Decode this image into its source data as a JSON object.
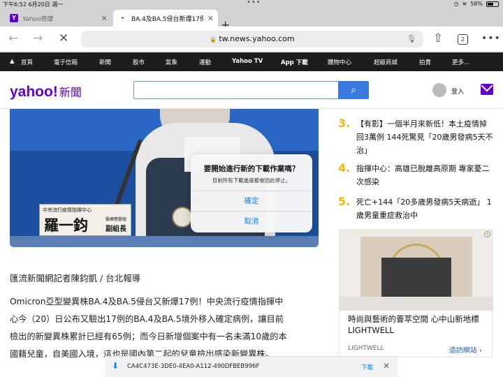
{
  "status": {
    "time": "下午6:52  6月20日 週一",
    "battery": "58%",
    "battery_level": 0.58
  },
  "tabs": [
    {
      "title": "Yahoo奇摩",
      "active": false
    },
    {
      "title": "BA.4及BA.5侵台新爆17例",
      "active": true
    }
  ],
  "address": {
    "url": "tw.news.yahoo.com",
    "tab_count": "2"
  },
  "nav": [
    "首頁",
    "電子信箱",
    "新聞",
    "股市",
    "氣象",
    "運動",
    "Yahoo TV",
    "App 下載",
    "購物中心",
    "超級商城",
    "拍賣",
    "更多..."
  ],
  "header": {
    "logo": "yahoo!",
    "logo_sub": "新聞",
    "search_placeholder": "",
    "login_label": "登入"
  },
  "hero": {
    "nameplate_title": "中央流行疫情指揮中心",
    "nameplate_name": "羅一鈞",
    "nameplate_role_small": "醫療應變組",
    "nameplate_role": "副組長"
  },
  "trending": [
    {
      "num": "3.",
      "text": "【有影】一個半月來新低！本土疫情掉回3萬例 144死驚見「20歲男發病5天不治」"
    },
    {
      "num": "4.",
      "text": "指揮中心：高雄已脫離高原期 專家憂二次感染"
    },
    {
      "num": "5.",
      "text": "死亡+144「20多歲男發病5天病逝」 1歲男童重症救治中"
    }
  ],
  "ad": {
    "headline": "時尚與藝術的薈萃空間 心中山新地標 LIGHTWELL",
    "brand": "LIGHTWELL",
    "cta": "造訪網站 ›"
  },
  "article": {
    "byline": "匯流新聞網記者陳鈞凱 / 台北報導",
    "body": "Omicron亞型變異株BA.4及BA.5侵台又新爆17例！中央流行疫情指揮中心今（20）日公布又驗出17例的BA.4及BA.5境外移入確定病例，讓目前檢出的新變異株累計已經有65例；而今日新增個案中有一名未滿10歲的本國籍兒童，自美國入境，這也是國內第二起的兒童檢出感染新變異株。"
  },
  "download": {
    "filename": "CA4C473E-3DE0-4EA0-A112-490DFBEB996F",
    "button": "下載"
  },
  "dialog": {
    "title": "要開始進行新的下載作業嗎？",
    "message": "目前所有下載進度都會因此停止。",
    "confirm": "確定",
    "cancel": "取消"
  }
}
